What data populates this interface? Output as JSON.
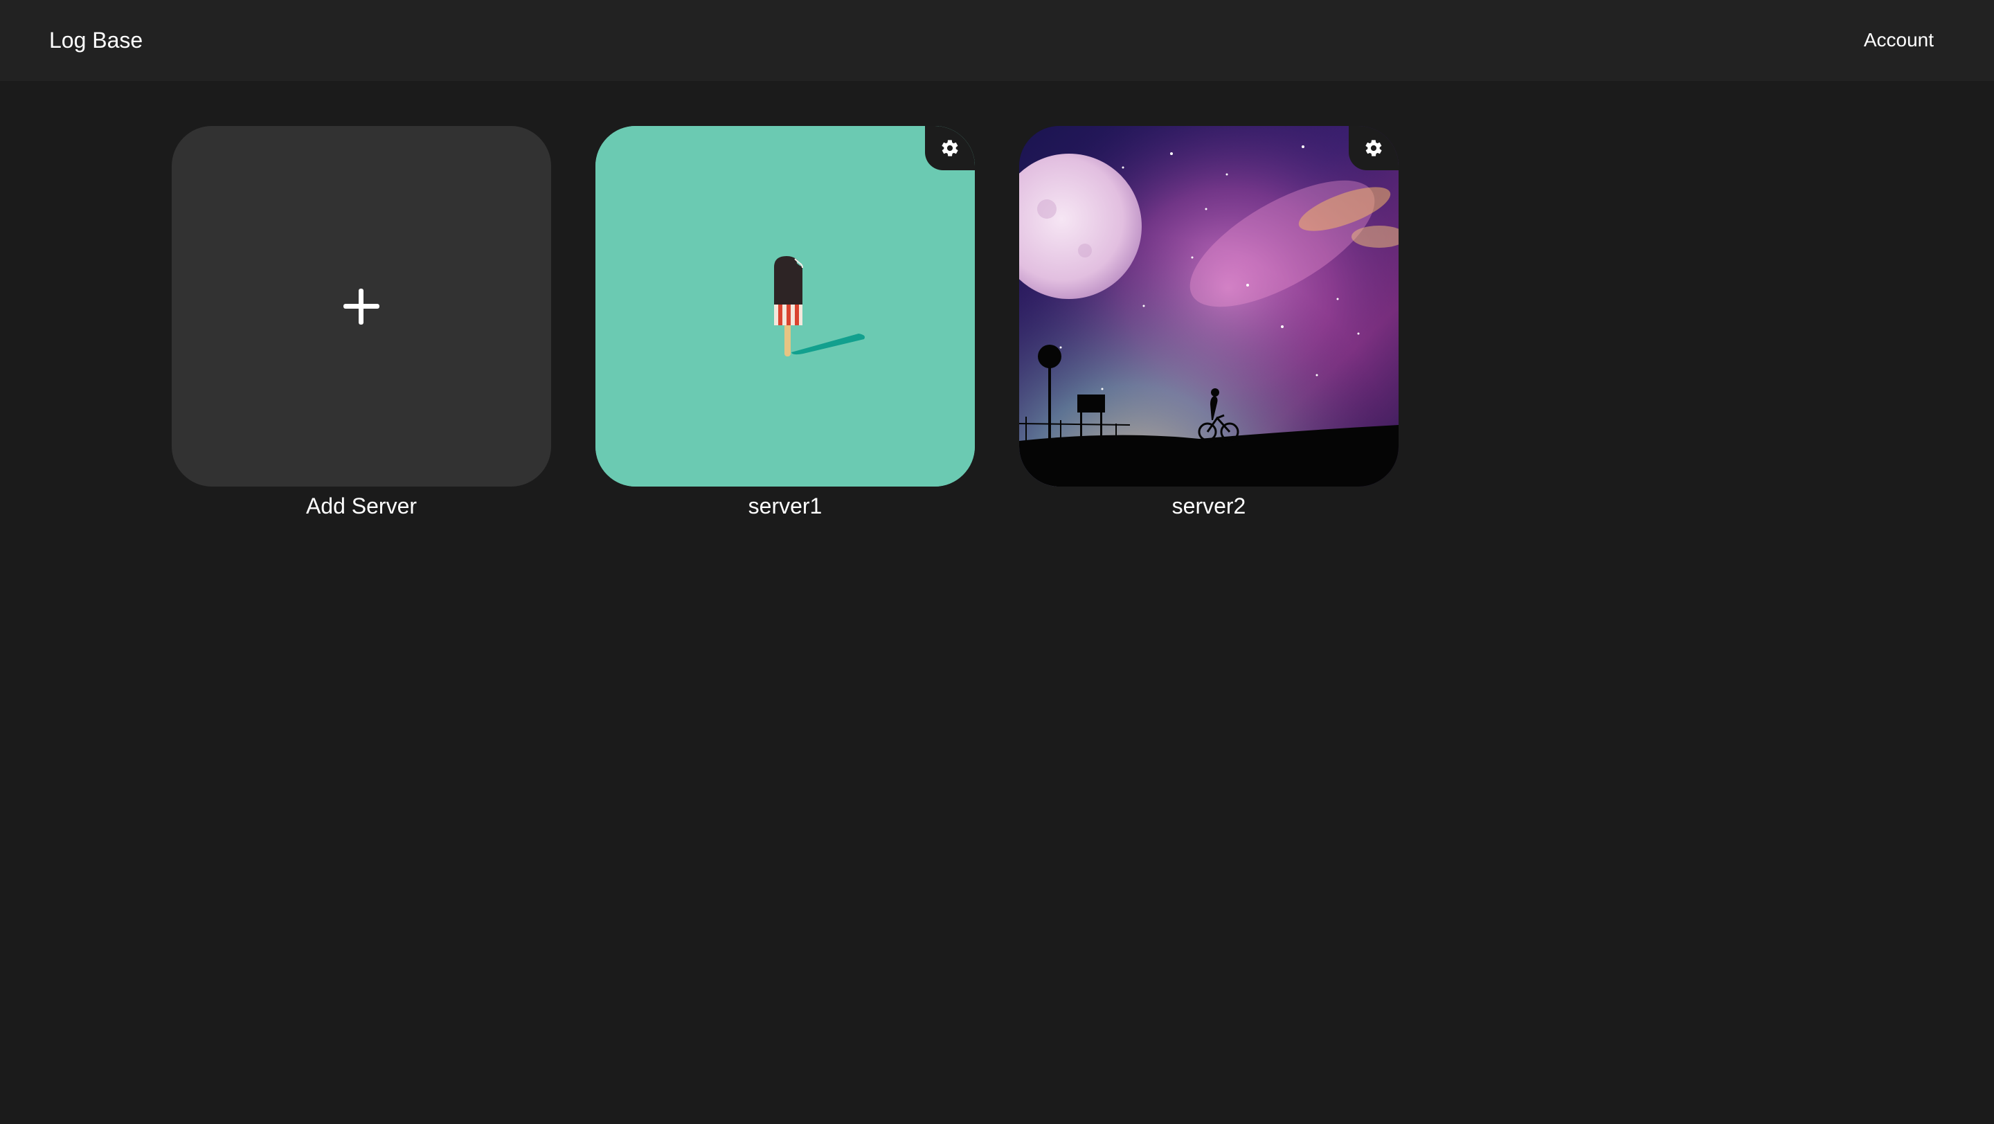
{
  "header": {
    "title": "Log Base",
    "account_label": "Account"
  },
  "servers": {
    "add": {
      "label": "Add Server",
      "icon": "plus-icon"
    },
    "items": [
      {
        "name": "server1",
        "settings_icon": "gear-icon",
        "image": "popsicle-illustration",
        "accent": "#6bcab2"
      },
      {
        "name": "server2",
        "settings_icon": "gear-icon",
        "image": "night-sky-galaxy",
        "accent": "#14103a"
      }
    ]
  },
  "colors": {
    "background": "#1b1b1b",
    "header": "#222222",
    "add_tile": "#323232"
  }
}
